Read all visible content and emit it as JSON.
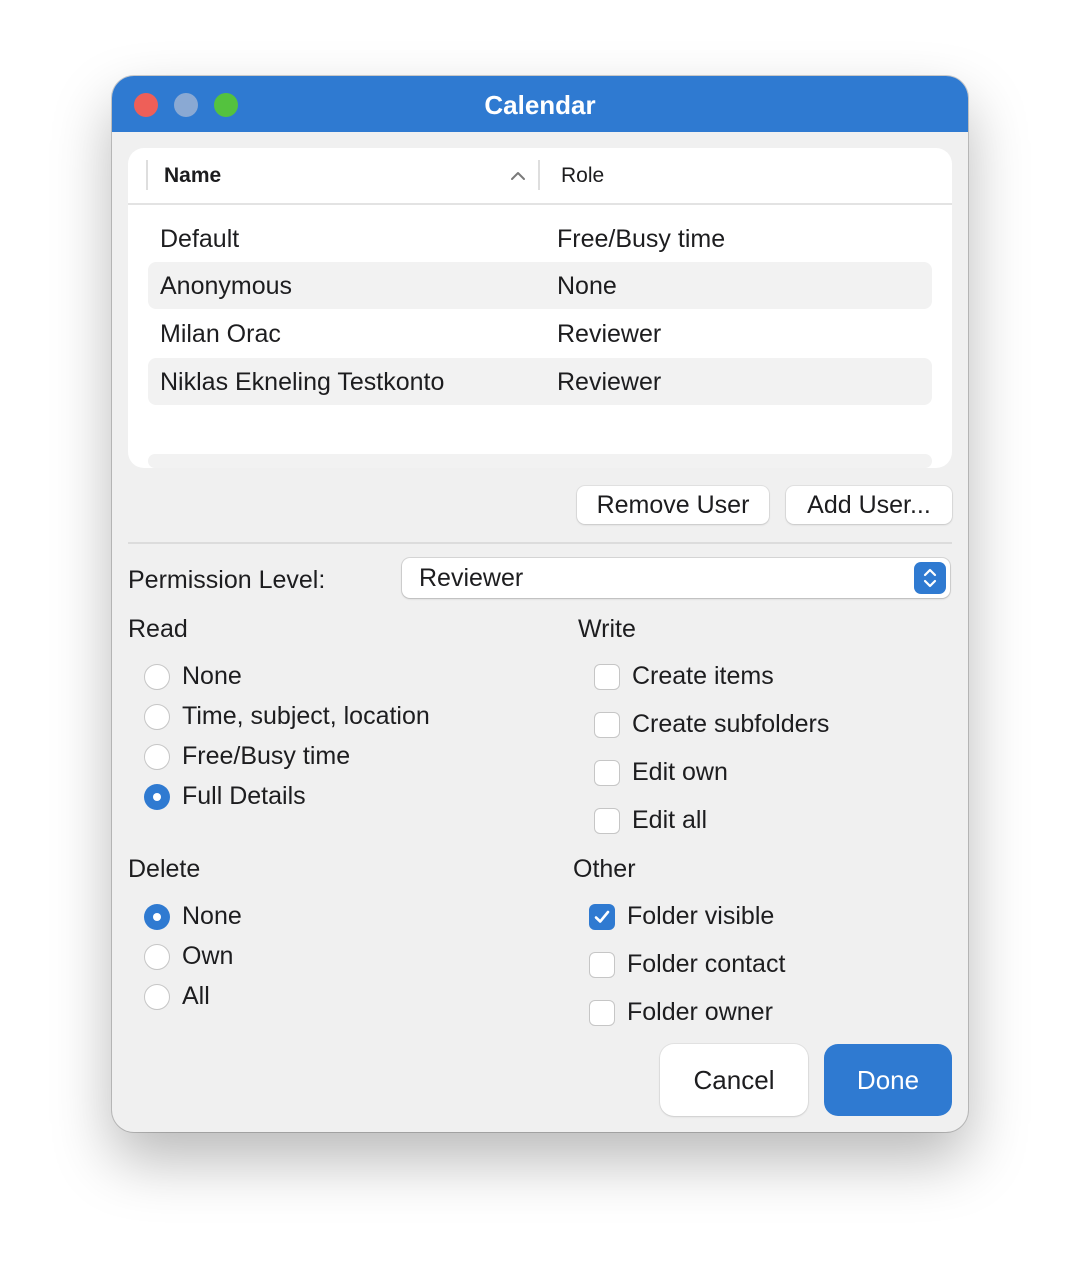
{
  "window": {
    "title": "Calendar"
  },
  "table": {
    "columns": {
      "name": "Name",
      "role": "Role"
    },
    "rows": [
      {
        "name": "Default",
        "role": "Free/Busy time"
      },
      {
        "name": "Anonymous",
        "role": "None"
      },
      {
        "name": "Milan Orac",
        "role": "Reviewer"
      },
      {
        "name": "Niklas Ekneling Testkonto",
        "role": "Reviewer"
      }
    ]
  },
  "actions": {
    "remove_user": "Remove User",
    "add_user": "Add User..."
  },
  "permission": {
    "label": "Permission Level:",
    "value": "Reviewer"
  },
  "read": {
    "title": "Read",
    "options": [
      "None",
      "Time, subject, location",
      "Free/Busy time",
      "Full Details"
    ],
    "selected": "Full Details"
  },
  "write": {
    "title": "Write",
    "options": [
      {
        "label": "Create items",
        "checked": false
      },
      {
        "label": "Create subfolders",
        "checked": false
      },
      {
        "label": "Edit own",
        "checked": false
      },
      {
        "label": "Edit all",
        "checked": false
      }
    ]
  },
  "delete": {
    "title": "Delete",
    "options": [
      "None",
      "Own",
      "All"
    ],
    "selected": "None"
  },
  "other": {
    "title": "Other",
    "options": [
      {
        "label": "Folder visible",
        "checked": true
      },
      {
        "label": "Folder contact",
        "checked": false
      },
      {
        "label": "Folder owner",
        "checked": false
      }
    ]
  },
  "footer": {
    "cancel": "Cancel",
    "done": "Done"
  },
  "colors": {
    "accent": "#2f7ad1",
    "titlebar": "#2f7ad1",
    "window_bg": "#f0f0f0"
  }
}
